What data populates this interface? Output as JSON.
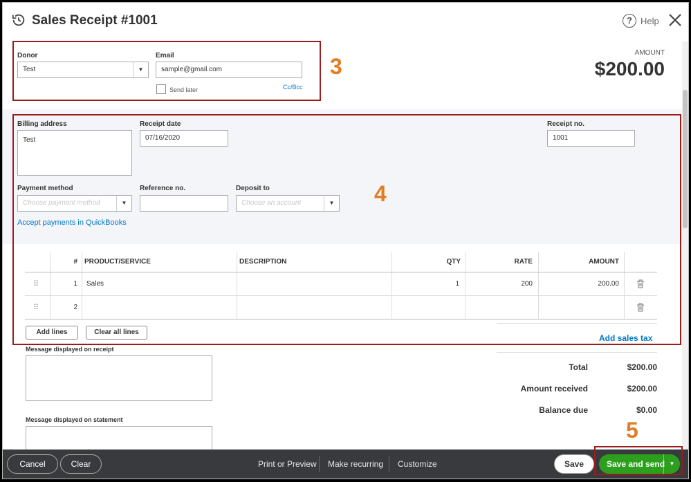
{
  "header": {
    "title": "Sales Receipt #1001",
    "help_label": "Help"
  },
  "amount": {
    "label": "AMOUNT",
    "value": "$200.00"
  },
  "donor": {
    "label": "Donor",
    "value": "Test"
  },
  "email": {
    "label": "Email",
    "value": "sample@gmail.com",
    "send_later": "Send later",
    "cc_bcc": "Cc/Bcc"
  },
  "billing": {
    "label": "Billing address",
    "value": "Test"
  },
  "receipt_date": {
    "label": "Receipt date",
    "value": "07/16/2020"
  },
  "receipt_no": {
    "label": "Receipt no.",
    "value": "1001"
  },
  "payment_method": {
    "label": "Payment method",
    "placeholder": "Choose payment method"
  },
  "reference_no": {
    "label": "Reference no.",
    "value": ""
  },
  "deposit_to": {
    "label": "Deposit to",
    "placeholder": "Choose an account"
  },
  "accept_payments_link": "Accept payments in QuickBooks",
  "table": {
    "headers": {
      "num": "#",
      "product": "PRODUCT/SERVICE",
      "description": "DESCRIPTION",
      "qty": "QTY",
      "rate": "RATE",
      "amount": "AMOUNT"
    },
    "rows": [
      {
        "num": "1",
        "product": "Sales",
        "description": "",
        "qty": "1",
        "rate": "200",
        "amount": "200.00"
      },
      {
        "num": "2",
        "product": "",
        "description": "",
        "qty": "",
        "rate": "",
        "amount": ""
      }
    ]
  },
  "add_lines": "Add lines",
  "clear_all_lines": "Clear all lines",
  "add_sales_tax": "Add sales tax",
  "message_receipt_label": "Message displayed on receipt",
  "message_statement_label": "Message displayed on statement",
  "totals": {
    "total_label": "Total",
    "total_value": "$200.00",
    "received_label": "Amount received",
    "received_value": "$200.00",
    "balance_label": "Balance due",
    "balance_value": "$0.00"
  },
  "annotations": {
    "a3": "3",
    "a4": "4",
    "a5": "5"
  },
  "footer": {
    "cancel": "Cancel",
    "clear": "Clear",
    "print_preview": "Print or Preview",
    "make_recurring": "Make recurring",
    "customize": "Customize",
    "save": "Save",
    "save_and_send": "Save and send"
  },
  "colors": {
    "accent_green": "#2ca01c",
    "link_blue": "#0077c5",
    "annotation_red": "#9b1c1c",
    "annotation_orange": "#e07e25",
    "footer_bg": "#393a3d"
  }
}
